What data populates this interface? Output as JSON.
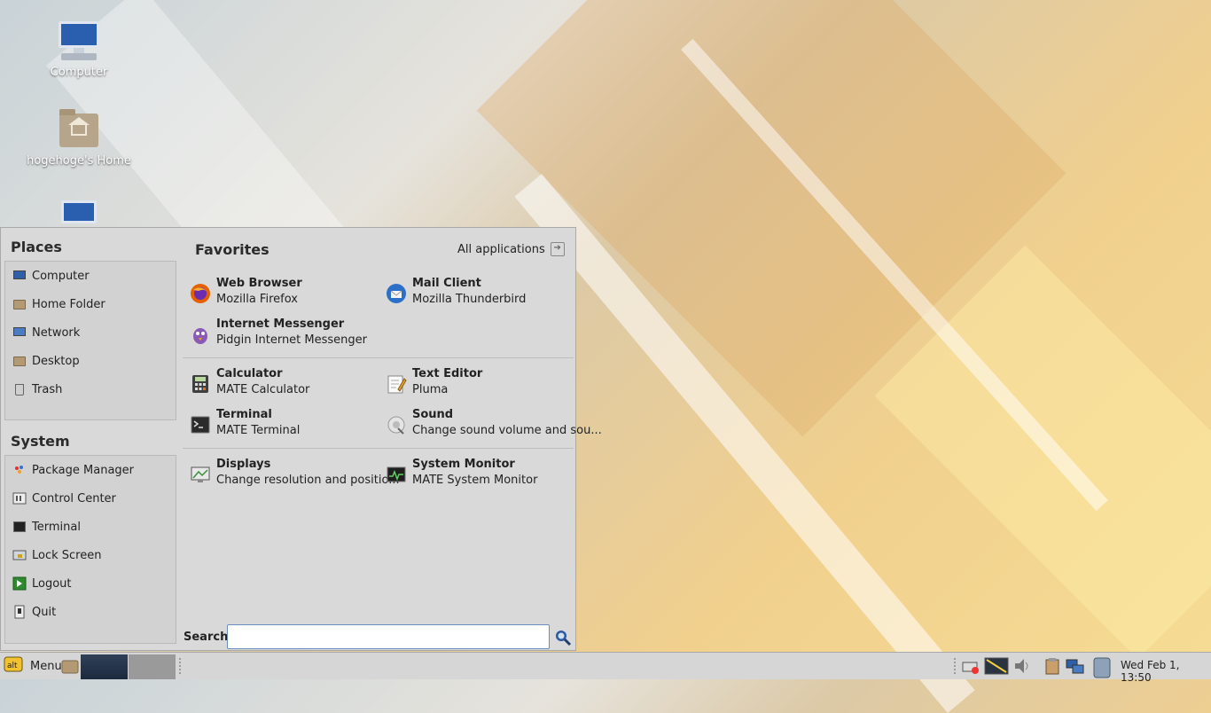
{
  "desktop": {
    "icons": [
      {
        "label": "Computer"
      },
      {
        "label": "hogehoge's Home"
      },
      {
        "label": ""
      }
    ]
  },
  "menu": {
    "places_title": "Places",
    "places": [
      {
        "label": "Computer",
        "icon": "computer-icon"
      },
      {
        "label": "Home Folder",
        "icon": "home-folder-icon"
      },
      {
        "label": "Network",
        "icon": "network-icon"
      },
      {
        "label": "Desktop",
        "icon": "desktop-folder-icon"
      },
      {
        "label": "Trash",
        "icon": "trash-icon"
      }
    ],
    "system_title": "System",
    "system": [
      {
        "label": "Package Manager",
        "icon": "package-manager-icon"
      },
      {
        "label": "Control Center",
        "icon": "control-center-icon"
      },
      {
        "label": "Terminal",
        "icon": "terminal-icon"
      },
      {
        "label": "Lock Screen",
        "icon": "lock-screen-icon"
      },
      {
        "label": "Logout",
        "icon": "logout-icon"
      },
      {
        "label": "Quit",
        "icon": "quit-icon"
      }
    ],
    "favorites_title": "Favorites",
    "all_applications": "All applications",
    "favorites": [
      {
        "title": "Web Browser",
        "subtitle": "Mozilla Firefox",
        "icon": "firefox-icon"
      },
      {
        "title": "Mail Client",
        "subtitle": "Mozilla Thunderbird",
        "icon": "thunderbird-icon"
      },
      {
        "title": "Internet Messenger",
        "subtitle": "Pidgin Internet Messenger",
        "icon": "pidgin-icon"
      },
      {
        "title": "Calculator",
        "subtitle": "MATE Calculator",
        "icon": "calculator-icon"
      },
      {
        "title": "Text Editor",
        "subtitle": "Pluma",
        "icon": "text-editor-icon"
      },
      {
        "title": "Terminal",
        "subtitle": "MATE Terminal",
        "icon": "terminal-icon"
      },
      {
        "title": "Sound",
        "subtitle": "Change sound volume and sou...",
        "icon": "sound-icon"
      },
      {
        "title": "Displays",
        "subtitle": "Change resolution and positio...",
        "icon": "displays-icon"
      },
      {
        "title": "System Monitor",
        "subtitle": "MATE System Monitor",
        "icon": "system-monitor-icon"
      }
    ],
    "search_label": "Search:",
    "search_value": "",
    "search_placeholder": ""
  },
  "panel": {
    "menu_label": "Menu",
    "clock": "Wed Feb  1, 13:50"
  }
}
